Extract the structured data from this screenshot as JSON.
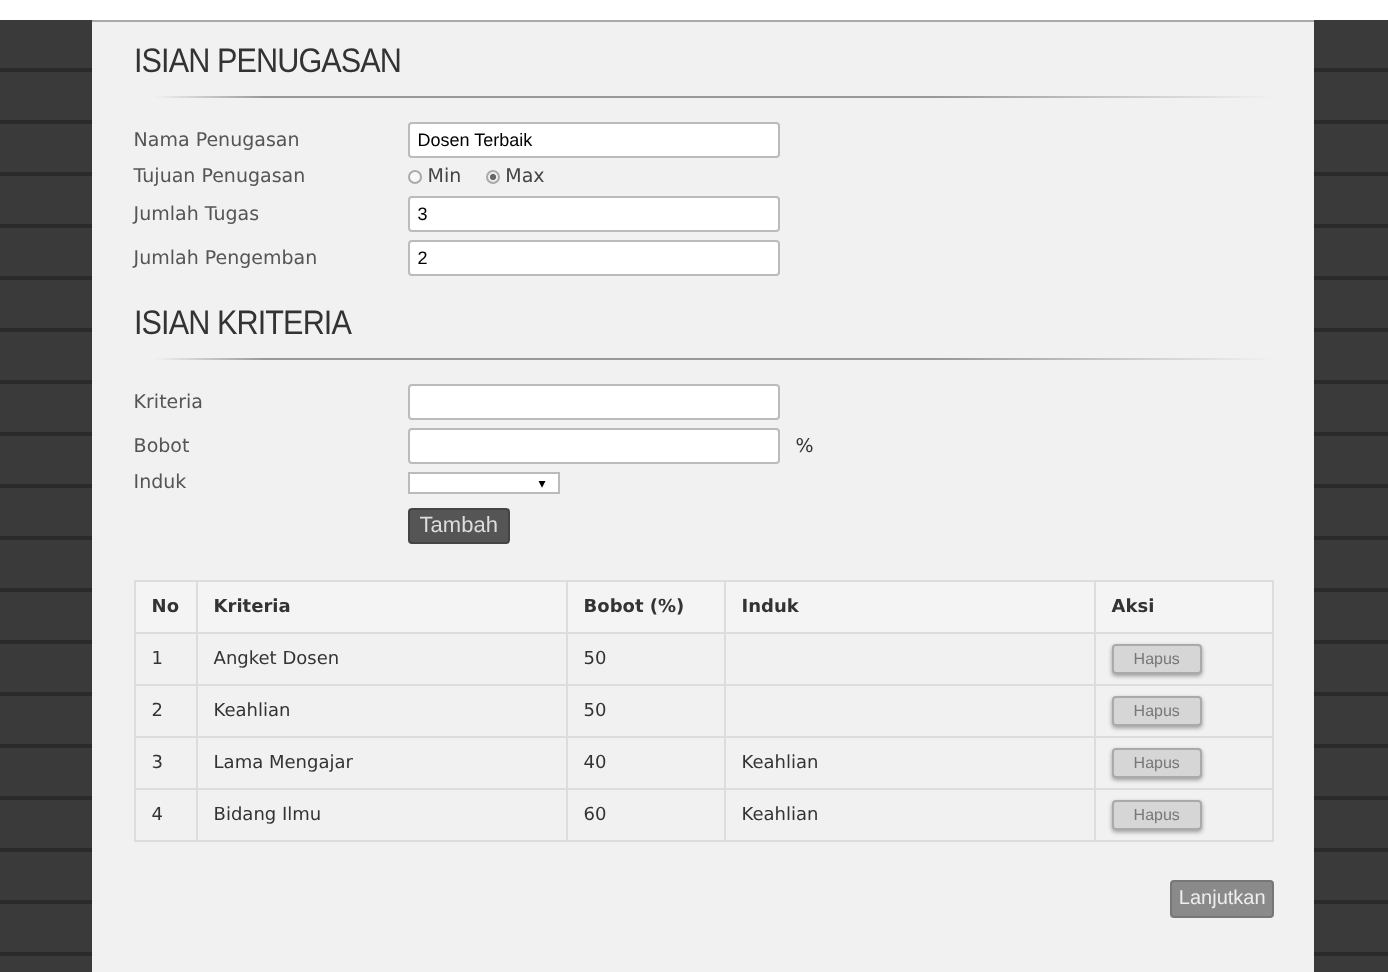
{
  "sections": [
    {
      "title": "ISIAN PENUGASAN"
    },
    {
      "title": "ISIAN KRITERIA"
    }
  ],
  "assignment_fields": [
    {
      "kind": "text",
      "label": "Nama Penugasan",
      "value": "Dosen Terbaik"
    },
    {
      "kind": "radio",
      "label": "Tujuan Penugasan",
      "options": [
        {
          "label": "Min",
          "selected": false
        },
        {
          "label": "Max",
          "selected": true
        }
      ]
    },
    {
      "kind": "text",
      "label": "Jumlah Tugas",
      "value": "3"
    },
    {
      "kind": "text",
      "label": "Jumlah Pengemban",
      "value": "2"
    }
  ],
  "criteria_fields": [
    {
      "kind": "text",
      "label": "Kriteria"
    },
    {
      "kind": "percent",
      "label": "Bobot",
      "suffix": "%"
    },
    {
      "kind": "select",
      "label": "Induk",
      "caret": "▾"
    }
  ],
  "add_button": "Tambah",
  "table": {
    "columns": [
      "No",
      "Kriteria",
      "Bobot (%)",
      "Induk",
      "Aksi"
    ],
    "rows": [
      {
        "no": "1",
        "kriteria": "Angket Dosen",
        "bobot": "50",
        "action": "Hapus",
        "action_disabled": true
      },
      {
        "no": "2",
        "kriteria": "Keahlian",
        "bobot": "50",
        "action": "Hapus",
        "action_disabled": true
      },
      {
        "no": "3",
        "kriteria": "Lama Mengajar",
        "bobot": "40",
        "induk": "Keahlian",
        "action": "Hapus",
        "action_disabled": true
      },
      {
        "no": "4",
        "kriteria": "Bidang Ilmu",
        "bobot": "60",
        "induk": "Keahlian",
        "action": "Hapus",
        "action_disabled": true
      }
    ]
  },
  "continue_button": "Lanjutkan"
}
